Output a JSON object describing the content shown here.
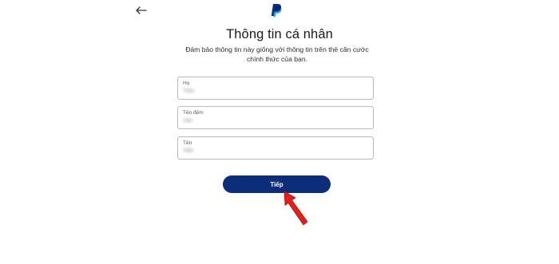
{
  "header": {
    "back_icon": "arrow-left-icon",
    "logo_icon": "paypal-logo-icon"
  },
  "form": {
    "title": "Thông tin cá nhân",
    "subtitle": "Đảm bảo thông tin này giống với thông tin trên thẻ căn cước chính thức của bạn.",
    "fields": [
      {
        "label": "Họ",
        "value": "Trần"
      },
      {
        "label": "Tên đệm",
        "value": "Văn"
      },
      {
        "label": "Tên",
        "value": "Tiến"
      }
    ],
    "next_label": "Tiếp"
  },
  "annotation": {
    "pointer_icon": "red-arrow-pointer-icon",
    "color": "#e0201b"
  },
  "colors": {
    "button": "#0b2d7a",
    "logo_dark": "#003087",
    "logo_light": "#009cde"
  }
}
